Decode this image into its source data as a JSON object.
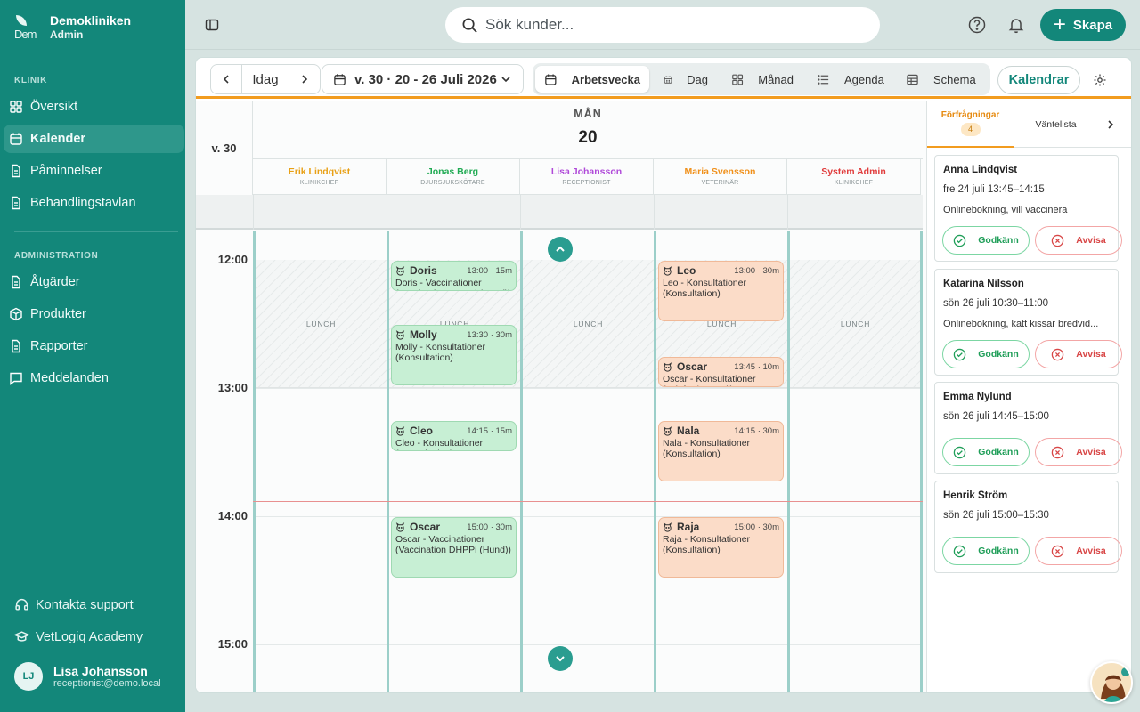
{
  "brand": {
    "name": "Demokliniken",
    "role": "Admin",
    "logo_text": "Dem"
  },
  "sidebar": {
    "section_klinik": "KLINIK",
    "items_klinik": [
      {
        "label": "Översikt",
        "icon": "grid-icon"
      },
      {
        "label": "Kalender",
        "icon": "calendar-icon",
        "active": true
      },
      {
        "label": "Påminnelser",
        "icon": "document-icon"
      },
      {
        "label": "Behandlingstavlan",
        "icon": "document-icon"
      }
    ],
    "section_admin": "ADMINISTRATION",
    "items_admin": [
      {
        "label": "Åtgärder",
        "icon": "document-icon"
      },
      {
        "label": "Produkter",
        "icon": "box-icon"
      },
      {
        "label": "Rapporter",
        "icon": "document-icon"
      },
      {
        "label": "Meddelanden",
        "icon": "message-icon"
      }
    ],
    "support": "Kontakta support",
    "academy": "VetLogiq Academy",
    "user": {
      "initials": "LJ",
      "name": "Lisa Johansson",
      "email": "receptionist@demo.local"
    }
  },
  "topbar": {
    "search_placeholder": "Sök kunder...",
    "create_label": "Skapa"
  },
  "toolbar": {
    "today": "Idag",
    "week_range": "v. 30 · 20 - 26 Juli 2026",
    "views": [
      "Arbetsvecka",
      "Dag",
      "Månad",
      "Agenda",
      "Schema"
    ],
    "active_view": "Arbetsvecka",
    "calendars": "Kalendrar"
  },
  "calendar": {
    "week_label": "v. 30",
    "day_name": "MÅN",
    "day_number": "20",
    "staff": [
      {
        "name": "Erik Lindqvist",
        "role": "KLINIKCHEF",
        "color": "#e8a015"
      },
      {
        "name": "Jonas Berg",
        "role": "DJURSJUKSKÖTARE",
        "color": "#1faa52"
      },
      {
        "name": "Lisa Johansson",
        "role": "RECEPTIONIST",
        "color": "#b04ad9"
      },
      {
        "name": "Maria Svensson",
        "role": "VETERINÄR",
        "color": "#f0901a"
      },
      {
        "name": "System Admin",
        "role": "KLINIKCHEF",
        "color": "#e03c3c"
      }
    ],
    "times": [
      "12:00",
      "13:00",
      "14:00",
      "15:00"
    ],
    "lunch_label": "LUNCH",
    "appointments": [
      {
        "col": 1,
        "name": "Doris",
        "time": "13:00 · 15m",
        "desc": "Doris - Vaccinationer (Vaccination DHPPi (Hund))",
        "color": "g",
        "start_min": 60,
        "dur": 15
      },
      {
        "col": 1,
        "name": "Molly",
        "time": "13:30 · 30m",
        "desc": "Molly - Konsultationer (Konsultation)",
        "color": "g",
        "start_min": 90,
        "dur": 30
      },
      {
        "col": 1,
        "name": "Cleo",
        "time": "14:15 · 15m",
        "desc": "Cleo - Konsultationer (Konsultation)",
        "color": "g",
        "start_min": 135,
        "dur": 15
      },
      {
        "col": 1,
        "name": "Oscar",
        "time": "15:00 · 30m",
        "desc": "Oscar - Vaccinationer (Vaccination DHPPi (Hund))",
        "color": "g",
        "start_min": 180,
        "dur": 30
      },
      {
        "col": 3,
        "name": "Leo",
        "time": "13:00 · 30m",
        "desc": "Leo - Konsultationer (Konsultation)",
        "color": "o",
        "start_min": 60,
        "dur": 30
      },
      {
        "col": 3,
        "name": "Oscar",
        "time": "13:45 · 10m",
        "desc": "Oscar - Konsultationer (Telefon/Kontroll)",
        "color": "o",
        "start_min": 105,
        "dur": 10
      },
      {
        "col": 3,
        "name": "Nala",
        "time": "14:15 · 30m",
        "desc": "Nala - Konsultationer (Konsultation)",
        "color": "o",
        "start_min": 135,
        "dur": 30
      },
      {
        "col": 3,
        "name": "Raja",
        "time": "15:00 · 30m",
        "desc": "Raja - Konsultationer (Konsultation)",
        "color": "o",
        "start_min": 180,
        "dur": 30
      }
    ]
  },
  "panel": {
    "tab_requests": "Förfrågningar",
    "requests_count": "4",
    "tab_waitlist": "Väntelista",
    "approve": "Godkänn",
    "reject": "Avvisa",
    "requests": [
      {
        "name": "Anna Lindqvist",
        "time": "fre 24 juli 13:45–14:15",
        "note": "Onlinebokning, vill vaccinera"
      },
      {
        "name": "Katarina Nilsson",
        "time": "sön 26 juli 10:30–11:00",
        "note": "Onlinebokning, katt kissar bredvid..."
      },
      {
        "name": "Emma Nylund",
        "time": "sön 26 juli 14:45–15:00",
        "note": ""
      },
      {
        "name": "Henrik Ström",
        "time": "sön 26 juli 15:00–15:30",
        "note": ""
      }
    ]
  }
}
